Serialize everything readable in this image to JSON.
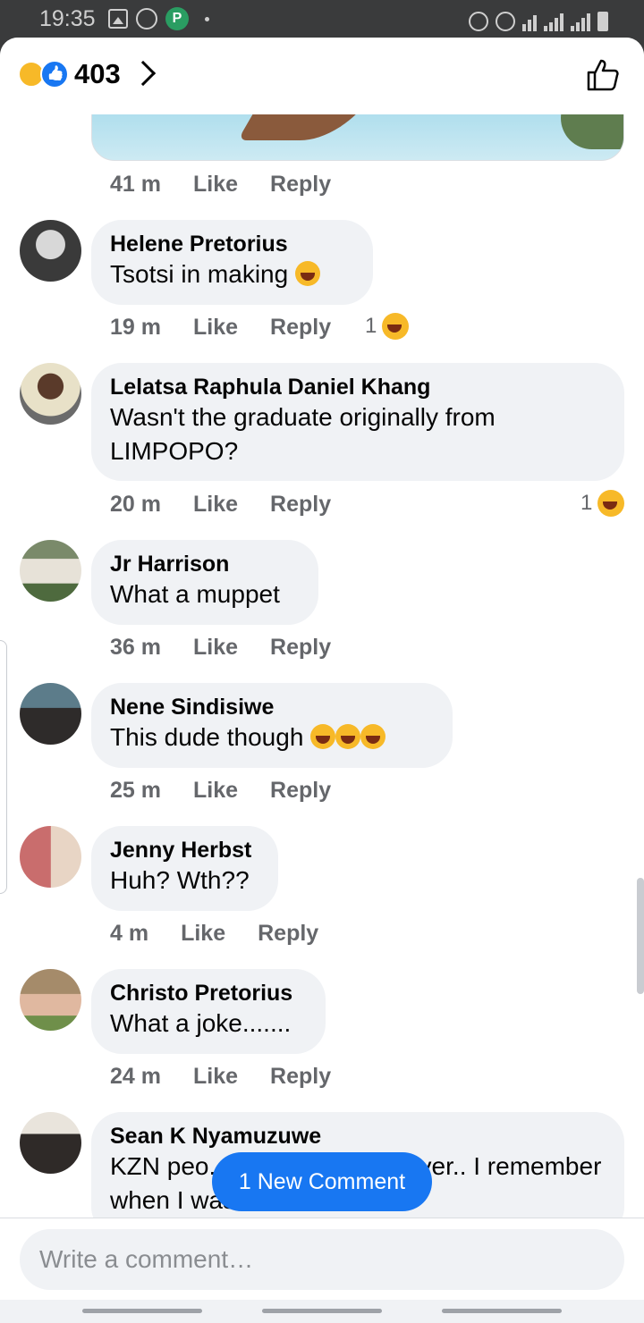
{
  "status_bar": {
    "time": "19:35"
  },
  "header": {
    "reaction_count": "403"
  },
  "comments": [
    {
      "name": "",
      "text": "",
      "time": "41 m",
      "like": "Like",
      "reply": "Reply"
    },
    {
      "name": "Helene Pretorius",
      "text": "Tsotsi in making",
      "time": "19 m",
      "like": "Like",
      "reply": "Reply",
      "reactions": "1"
    },
    {
      "name": "Lelatsa Raphula Daniel Khang",
      "text": "Wasn't the graduate originally from LIMPOPO?",
      "time": "20 m",
      "like": "Like",
      "reply": "Reply",
      "reactions": "1"
    },
    {
      "name": "Jr Harrison",
      "text": "What a muppet",
      "time": "36 m",
      "like": "Like",
      "reply": "Reply"
    },
    {
      "name": "Nene Sindisiwe",
      "text": "This dude though",
      "time": "25 m",
      "like": "Like",
      "reply": "Reply"
    },
    {
      "name": "Jenny Herbst",
      "text": "Huh? Wth??",
      "time": "4 m",
      "like": "Like",
      "reply": "Reply"
    },
    {
      "name": "Christo Pretorius",
      "text": "What a joke.......",
      "time": "24 m",
      "like": "Like",
      "reply": "Reply"
    },
    {
      "name": "Sean K Nyamuzuwe",
      "text": "KZN peo... jealous people ever.. I remember when I was there in"
    }
  ],
  "new_comment_label": "1 New Comment",
  "compose": {
    "placeholder": "Write a comment…"
  }
}
